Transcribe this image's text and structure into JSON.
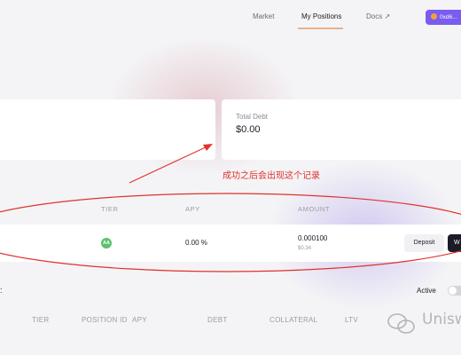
{
  "nav": {
    "market": "Market",
    "my_positions": "My Positions",
    "docs": "Docs ↗",
    "wallet": "0xd6..."
  },
  "stats": {
    "total_debt_label": "Total Debt",
    "total_debt_value": "$0.00"
  },
  "annotation": {
    "text": "成功之后会出现这个记录",
    "color": "#e0322e"
  },
  "positions_table": {
    "headers": [
      "TIER",
      "APY",
      "AMOUNT"
    ],
    "rows": [
      {
        "tier": "AA",
        "apy": "0.00 %",
        "amount": "0.000100",
        "amount_usd": "$0.34",
        "deposit_label": "Deposit",
        "withdraw_label": "W"
      }
    ]
  },
  "loans": {
    "title_fragment": ":",
    "active_label": "Active",
    "headers": [
      "TIER",
      "POSITION ID",
      "APY",
      "DEBT",
      "COLLATERAL",
      "LTV"
    ]
  },
  "watermark": {
    "text": "Unisw"
  },
  "colors": {
    "accent": "#7b5cf0",
    "nav_underline": "#e8b28a",
    "tier_aa": "#5cc26e"
  }
}
